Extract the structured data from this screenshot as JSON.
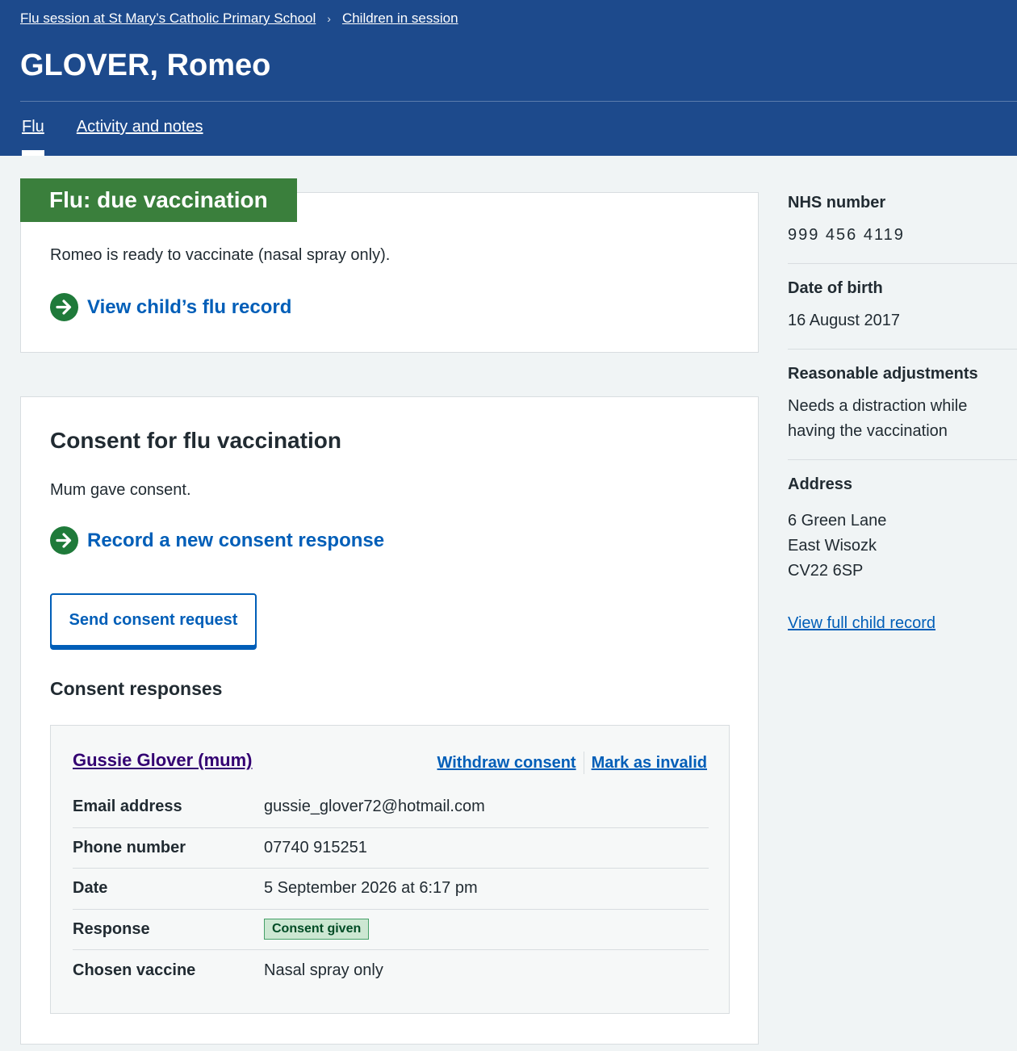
{
  "breadcrumb": {
    "session": "Flu session at St Mary’s Catholic Primary School",
    "children": "Children in session",
    "separator": "›"
  },
  "page_title": "GLOVER, Romeo",
  "tabs": [
    "Flu",
    "Activity and notes"
  ],
  "status": {
    "heading": "Flu: due vaccination",
    "text": "Romeo is ready to vaccinate (nasal spray only).",
    "link": "View child’s flu record",
    "color": "#3a7f3c"
  },
  "consent": {
    "title": "Consent for flu vaccination",
    "text": "Mum gave consent.",
    "record_link": "Record a new consent response",
    "send_button": "Send consent request",
    "responses_title": "Consent responses",
    "response": {
      "responder": "Gussie Glover (mum)",
      "withdraw": "Withdraw consent",
      "invalid": "Mark as invalid",
      "rows": [
        {
          "key": "Email address",
          "value": "gussie_glover72@hotmail.com"
        },
        {
          "key": "Phone number",
          "value": "07740 915251"
        },
        {
          "key": "Date",
          "value": "5 September 2026 at 6:17 pm"
        },
        {
          "key": "Response",
          "value": "Consent given"
        },
        {
          "key": "Chosen vaccine",
          "value": "Nasal spray only"
        }
      ]
    }
  },
  "sidebar": {
    "nhs_label": "NHS number",
    "nhs_value": "999 456 4119",
    "dob_label": "Date of birth",
    "dob_value": "16 August 2017",
    "adjust_label": "Reasonable adjustments",
    "adjust_value": "Needs a distraction while having the vaccination",
    "address_label": "Address",
    "address_lines": [
      "6 Green Lane",
      "East Wisozk",
      "CV22 6SP"
    ],
    "full_record_link": "View full child record"
  }
}
